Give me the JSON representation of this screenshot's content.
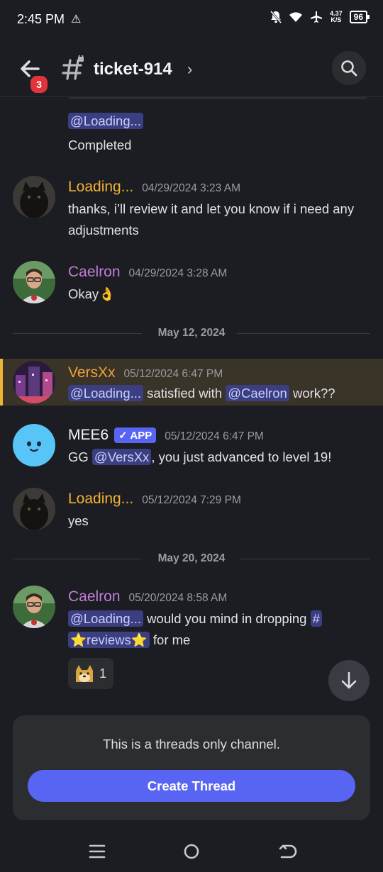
{
  "status_bar": {
    "time": "2:45 PM",
    "net_speed_top": "4.37",
    "net_speed_bottom": "K/S",
    "battery": "96"
  },
  "header": {
    "back_badge": "3",
    "channel_name": "ticket-914",
    "chevron": "›"
  },
  "messages": [
    {
      "id": "m0",
      "continued": true,
      "mention": "@Loading...",
      "text": "Completed"
    },
    {
      "id": "m1",
      "author": "Loading...",
      "author_color": "#f0b232",
      "timestamp": "04/29/2024 3:23 AM",
      "text": "thanks, i’ll review it and let you know if i need any adjustments"
    },
    {
      "id": "m2",
      "author": "Caelron",
      "author_color": "#c27ed7",
      "timestamp": "04/29/2024 3:28 AM",
      "text": "Okay👌"
    },
    {
      "id": "m3",
      "author": "VersXx",
      "author_color": "#f0a23a",
      "timestamp": "05/12/2024 6:47 PM",
      "mention1": "@Loading...",
      "text_mid": " satisfied with ",
      "mention2": "@Caelron",
      "text_end": " work??",
      "highlighted": true
    },
    {
      "id": "m4",
      "author": "MEE6",
      "author_color": "#f2f3f5",
      "app_badge": "✓ APP",
      "timestamp": "05/12/2024 6:47 PM",
      "text_start": "GG ",
      "mention": "@VersXx",
      "text_end": ", you just advanced to level 19!"
    },
    {
      "id": "m5",
      "author": "Loading...",
      "author_color": "#f0b232",
      "timestamp": "05/12/2024 7:29 PM",
      "text": "yes"
    },
    {
      "id": "m6",
      "author": "Caelron",
      "author_color": "#c27ed7",
      "timestamp": "05/20/2024 8:58 AM",
      "mention": "@Loading...",
      "text_mid": " would you mind in dropping ",
      "channel_hash": "#",
      "channel_mention": "⭐reviews⭐",
      "text_end": " for me",
      "reaction_count": "1"
    }
  ],
  "dividers": [
    "May 12, 2024",
    "May 20, 2024"
  ],
  "footer": {
    "notice": "This is a threads only channel.",
    "button": "Create Thread"
  },
  "colors": {
    "background": "#1c1d22",
    "accent": "#5865f2",
    "mention_bg": "#3b3f82"
  }
}
